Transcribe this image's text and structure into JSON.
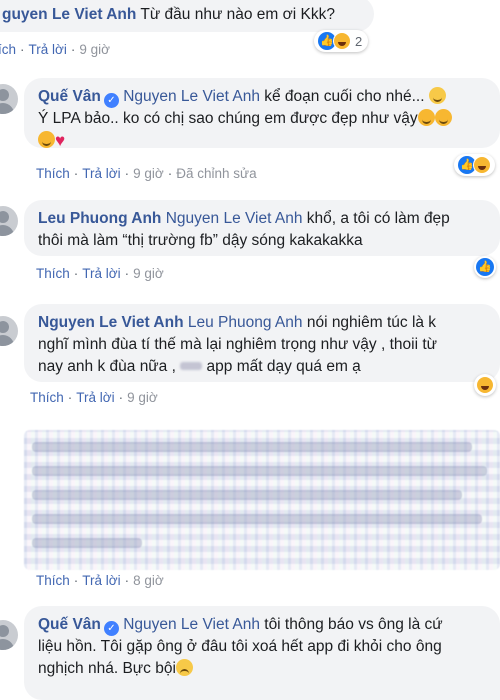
{
  "comment0": {
    "author": "guyen Le Viet Anh",
    "text": " Từ đầu như nào em ơi Kkk?",
    "actions": {
      "left_label": "ích",
      "reply": "Trả lời",
      "time": "9 giờ"
    },
    "reaction_count": "2"
  },
  "comment1": {
    "author": "Quế Vân",
    "mention": "Nguyen Le Viet Anh",
    "text_a": " kể đoạn cuối cho nhé...",
    "text_b": "Ý LPA bảo.. ko có chị sao chúng em được đẹp như vậy",
    "actions": {
      "like": "Thích",
      "reply": "Trả lời",
      "time": "9 giờ",
      "edited": "Đã chỉnh sửa"
    }
  },
  "comment2": {
    "author": "Leu Phuong Anh",
    "mention": "Nguyen Le Viet Anh",
    "text_a": " khổ, a tôi có làm đẹp",
    "text_b": "thôi mà làm “thị trường fb” dậy sóng kakakakka",
    "actions": {
      "like": "Thích",
      "reply": "Trả lời",
      "time": "9 giờ"
    }
  },
  "comment3": {
    "author": "Nguyen Le Viet Anh",
    "mention": "Leu Phuong Anh",
    "text_a": " nói nghiêm túc là k",
    "text_b": "nghĩ mình đùa tí thế mà lại nghiêm trọng như vậy , thoii từ",
    "text_c": "nay anh k đùa nữa , ",
    "text_d": " app mất dạy quá em ạ",
    "actions": {
      "like": "Thích",
      "reply": "Trả lời",
      "time": "9 giờ"
    }
  },
  "comment4": {
    "actions": {
      "like": "Thích",
      "reply": "Trả lời",
      "time": "8 giờ"
    }
  },
  "comment5": {
    "author": "Quế Vân",
    "mention": "Nguyen Le Viet Anh",
    "text_a": " tôi thông báo vs ông là cứ",
    "text_b": "liệu hồn. Tôi gặp ông ở đâu tôi xoá hết app đi khỏi cho ông",
    "text_c": "nghịch nhá. Bực bội"
  },
  "icons": [
    "verified-badge-icon",
    "like-reaction-icon",
    "haha-reaction-icon",
    "smile-emoji-icon",
    "laugh-emoji-icon",
    "heart-emoji-icon",
    "frown-emoji-icon",
    "avatar-placeholder-icon"
  ],
  "colors": {
    "link": "#385898",
    "bubble": "#f2f3f5",
    "action": "#4267b2",
    "muted": "#90949c",
    "like": "#1877f2"
  }
}
